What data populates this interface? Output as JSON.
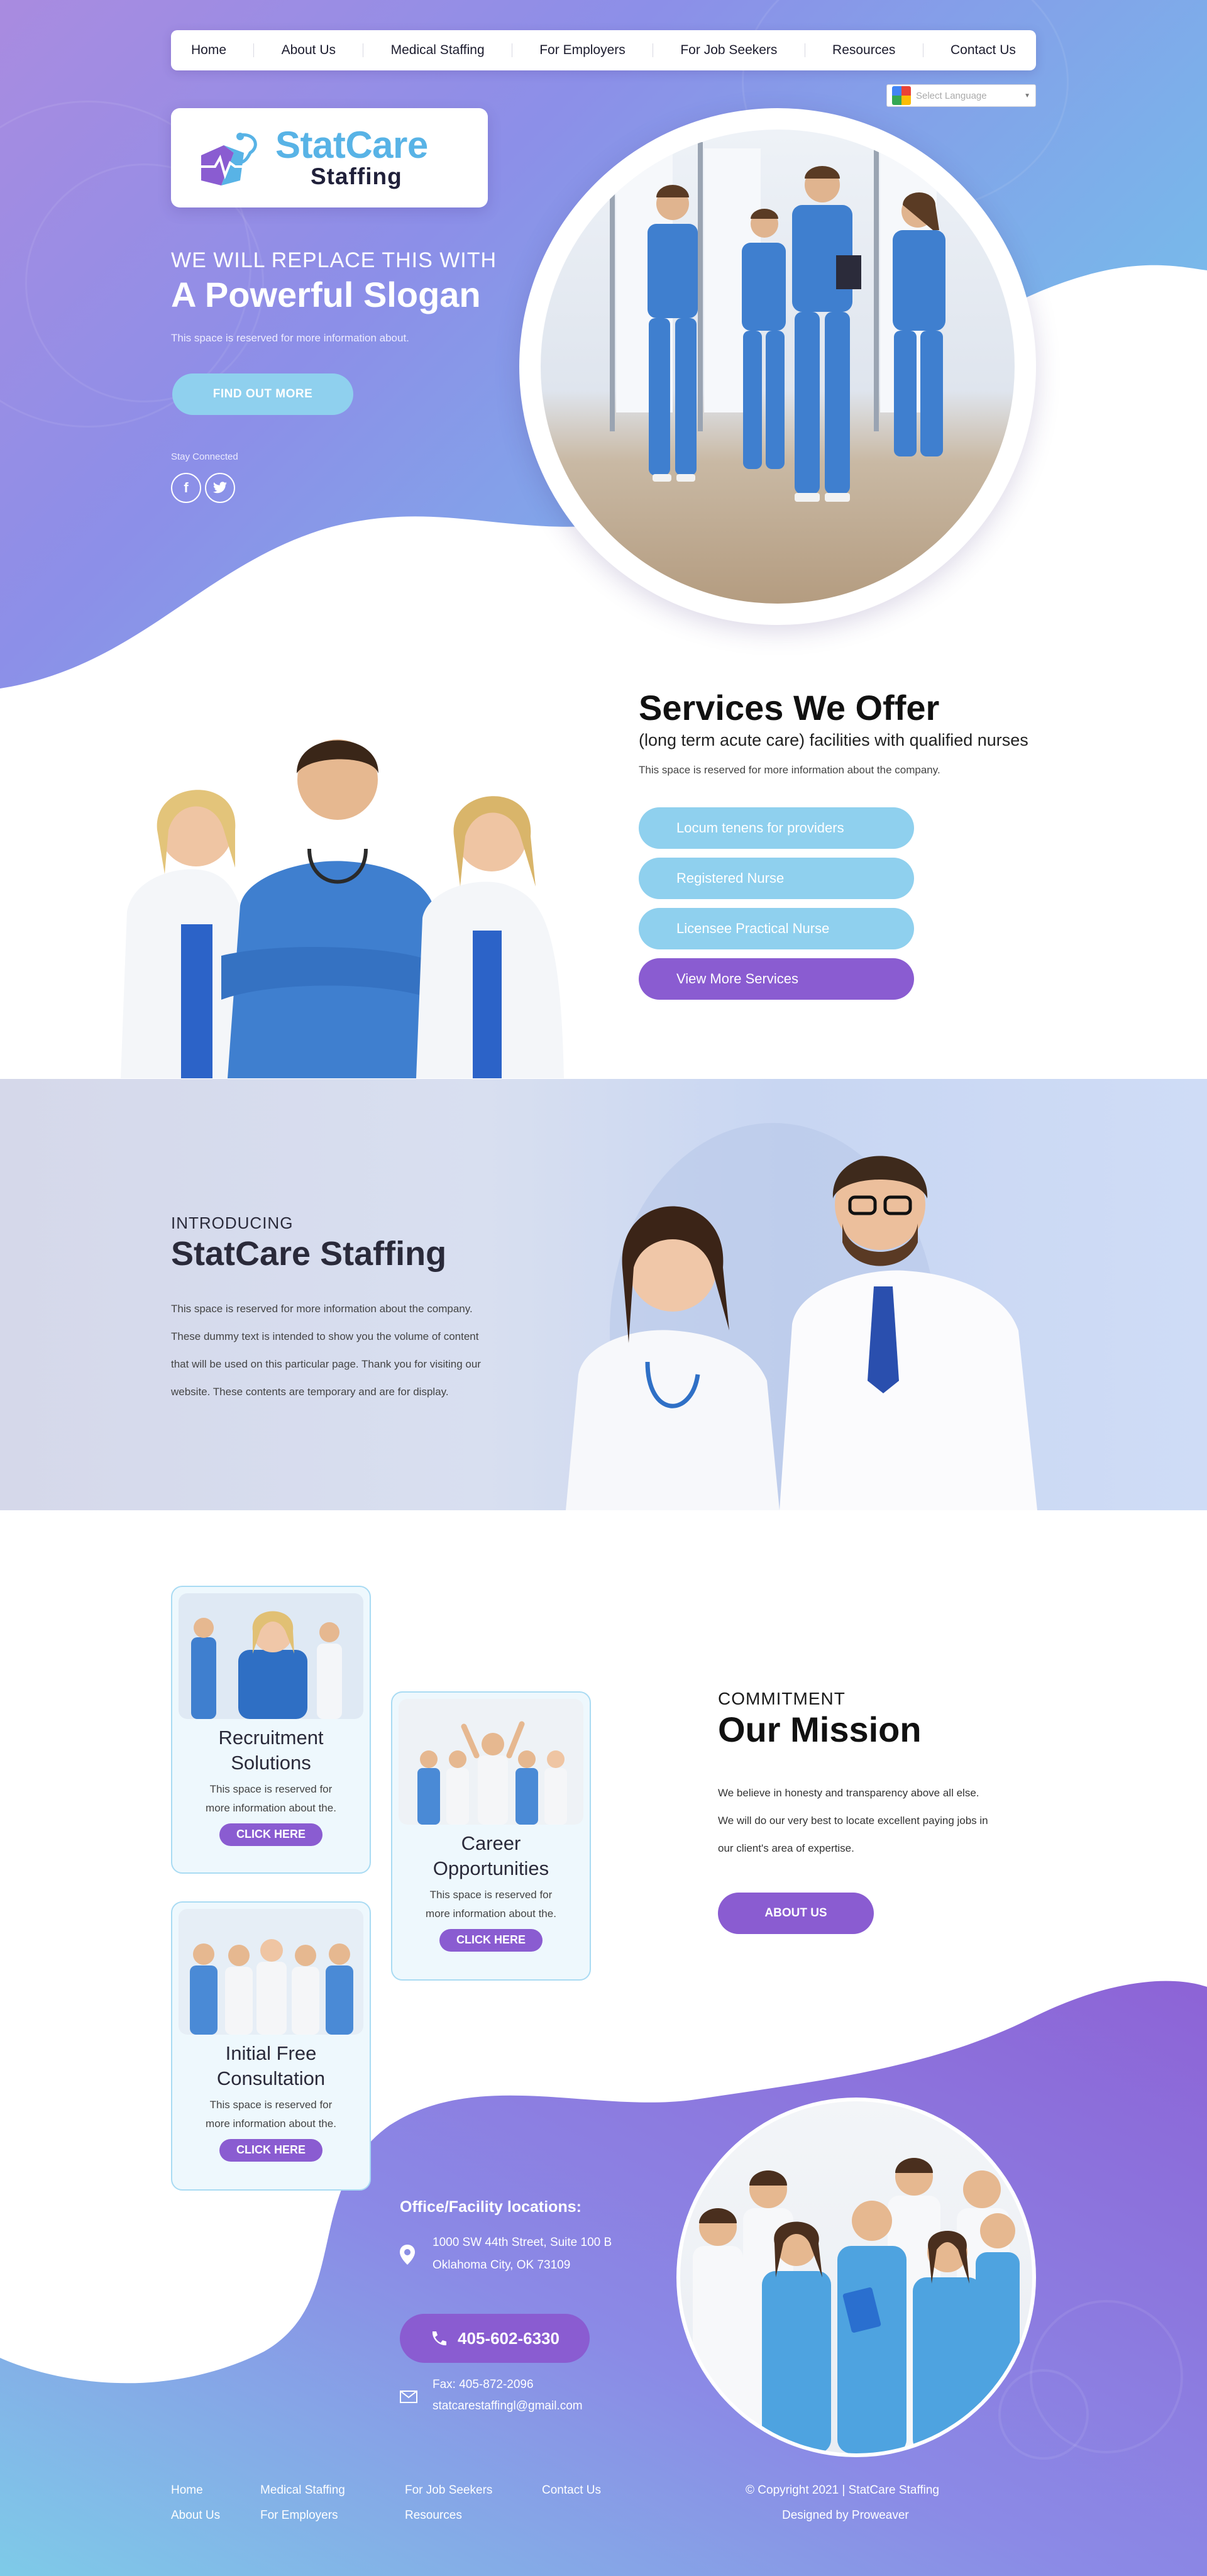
{
  "nav": {
    "items": [
      "Home",
      "About Us",
      "Medical Staffing",
      "For Employers",
      "For Job Seekers",
      "Resources",
      "Contact Us"
    ]
  },
  "language": {
    "placeholder": "Select Language"
  },
  "brand": {
    "name_line1": "StatCare",
    "name_line2": "Staffing"
  },
  "hero": {
    "pretitle": "WE WILL REPLACE THIS WITH",
    "title": "A Powerful Slogan",
    "description": "This space is reserved for more information about.",
    "button": "FIND OUT MORE",
    "stay_connected": "Stay Connected",
    "social": [
      {
        "name": "facebook-icon",
        "glyph": "f"
      },
      {
        "name": "twitter-icon",
        "glyph": "t"
      }
    ]
  },
  "services": {
    "title": "Services We Offer",
    "subtitle": "(long term acute care) facilities with qualified nurses",
    "description": "This space is reserved for more information about the company.",
    "buttons": [
      "Locum tenens for providers",
      "Registered Nurse",
      "Licensee Practical Nurse",
      "View More Services"
    ]
  },
  "intro": {
    "pretitle": "INTRODUCING",
    "title": "StatCare Staffing",
    "lines": [
      "This space is reserved for more information about the company.",
      "These dummy text is intended to show you the volume of content",
      "that will be used on this particular page.  Thank you for visiting our",
      "website. These contents are temporary and are for display."
    ]
  },
  "cards": [
    {
      "title_line1": "Recruitment",
      "title_line2": "Solutions",
      "desc_line1": "This space is reserved for",
      "desc_line2": "more information about the.",
      "button": "CLICK HERE"
    },
    {
      "title_line1": "Career",
      "title_line2": "Opportunities",
      "desc_line1": "This space is reserved for",
      "desc_line2": "more information about the.",
      "button": "CLICK HERE"
    },
    {
      "title_line1": "Initial Free",
      "title_line2": "Consultation",
      "desc_line1": "This space is reserved for",
      "desc_line2": "more information about the.",
      "button": "CLICK HERE"
    }
  ],
  "mission": {
    "pretitle": "COMMITMENT",
    "title": "Our Mission",
    "lines": [
      "We believe in honesty and transparency above all else.",
      "We will do our very best to locate excellent paying jobs in",
      "our client's area of expertise."
    ],
    "button": "ABOUT US"
  },
  "contact": {
    "title": "Office/Facility locations:",
    "address_line1": "1000 SW 44th Street, Suite 100 B",
    "address_line2": "Oklahoma City, OK 73109",
    "phone": "405-602-6330",
    "fax": "Fax:  405-872-2096",
    "email": "statcarestaffingl@gmail.com"
  },
  "footer": {
    "links": [
      "Home",
      "Medical Staffing",
      "For Job Seekers",
      "Contact Us",
      "About Us",
      "For Employers",
      "Resources"
    ],
    "copyright": "© Copyright 2021 | StatCare Staffing",
    "designed_by": "Designed by Proweaver"
  },
  "colors": {
    "accent_purple": "#8a5cd1",
    "accent_blue": "#8fd0ee",
    "brand_blue": "#58b3e6",
    "scrub_blue": "#3f7fcf"
  }
}
